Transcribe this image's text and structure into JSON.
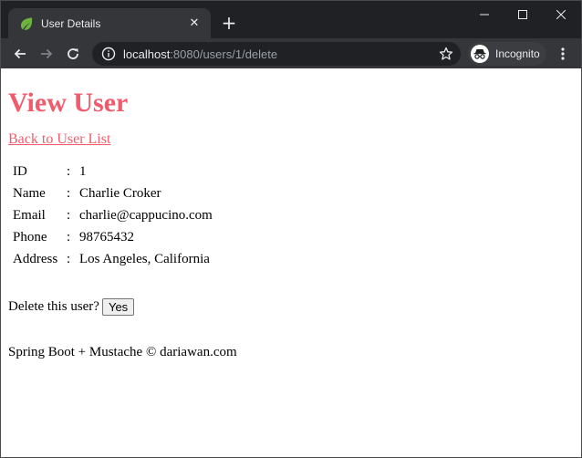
{
  "browser": {
    "tab_title": "User Details",
    "url_host": "localhost",
    "url_path": ":8080/users/1/delete",
    "profile_label": "Incognito",
    "colors": {
      "titlebar": "#202124",
      "toolbar": "#35363a",
      "favicon": "#6db33f"
    },
    "icons": [
      "spring-favicon",
      "close-icon",
      "plus-icon",
      "minimize-icon",
      "maximize-icon",
      "window-close-icon",
      "back-arrow-icon",
      "forward-arrow-icon",
      "reload-icon",
      "info-icon",
      "star-icon",
      "incognito-icon",
      "more-vert-icon"
    ]
  },
  "page": {
    "title": "View User",
    "back_link": "Back to User List",
    "separator": ":",
    "fields": [
      {
        "label": "ID",
        "value": "1"
      },
      {
        "label": "Name",
        "value": "Charlie Croker"
      },
      {
        "label": "Email",
        "value": "charlie@cappucino.com"
      },
      {
        "label": "Phone",
        "value": "98765432"
      },
      {
        "label": "Address",
        "value": "Los Angeles, California"
      }
    ],
    "delete_prompt": "Delete this user?",
    "yes_button": "Yes",
    "footer": "Spring Boot + Mustache © dariawan.com",
    "accent_color": "#f25b6b"
  }
}
